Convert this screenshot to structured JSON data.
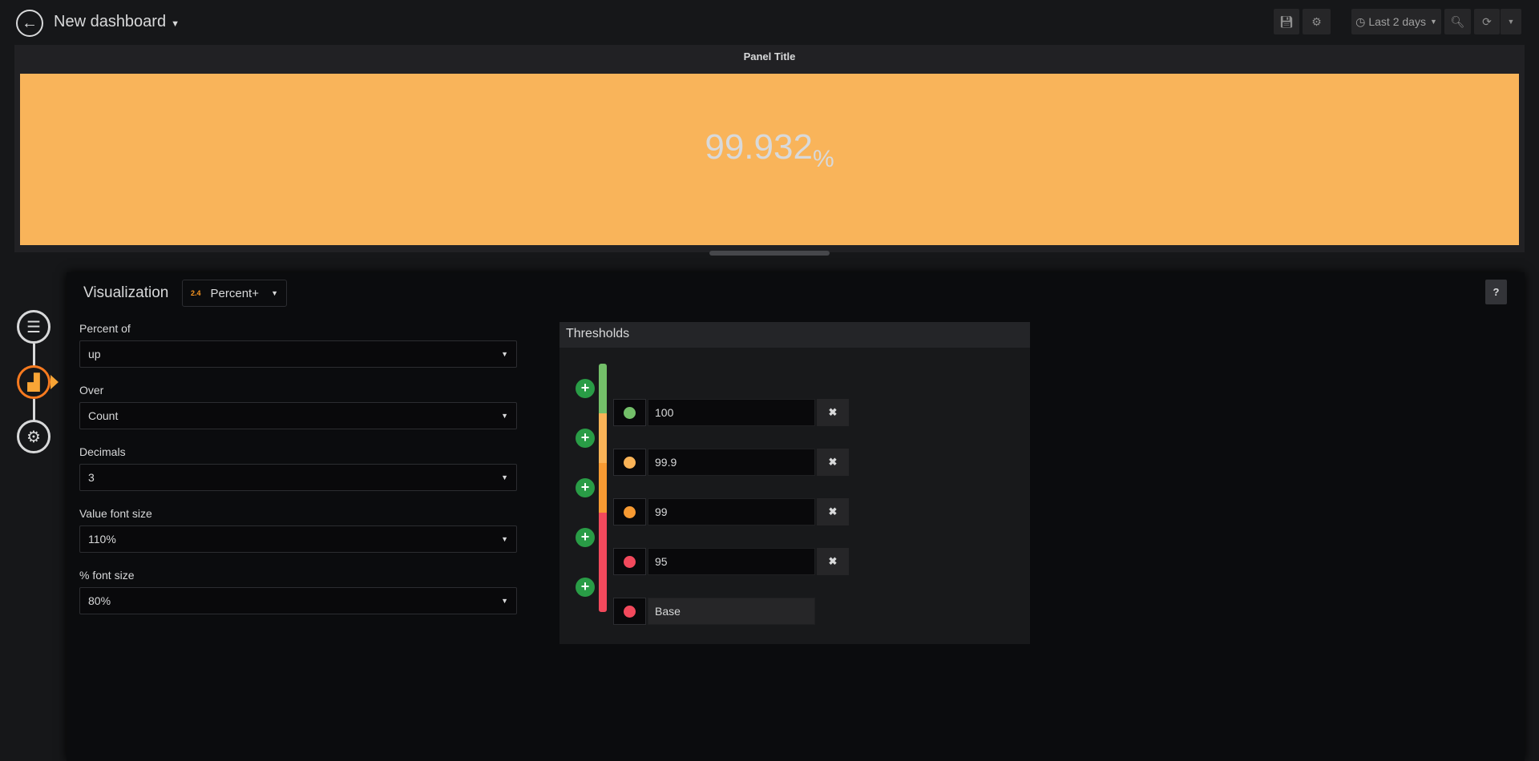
{
  "header": {
    "title": "New dashboard",
    "time_range": "Last 2 days"
  },
  "panel": {
    "title": "Panel Title",
    "value": "99.932",
    "unit": "%",
    "background": "#f9b45a"
  },
  "editor": {
    "visualization_label": "Visualization",
    "visualization_icon_text": "2.4",
    "visualization_type": "Percent+",
    "help_label": "?",
    "fields": [
      {
        "label": "Percent of",
        "value": "up"
      },
      {
        "label": "Over",
        "value": "Count"
      },
      {
        "label": "Decimals",
        "value": "3"
      },
      {
        "label": "Value font size",
        "value": "110%"
      },
      {
        "label": "% font size",
        "value": "80%"
      }
    ],
    "thresholds": {
      "title": "Thresholds",
      "items": [
        {
          "value": "100",
          "color": "#73bf69"
        },
        {
          "value": "99.9",
          "color": "#fab357"
        },
        {
          "value": "99",
          "color": "#f79a32"
        },
        {
          "value": "95",
          "color": "#f2495c"
        },
        {
          "value": "Base",
          "color": "#f2495c"
        }
      ]
    }
  }
}
